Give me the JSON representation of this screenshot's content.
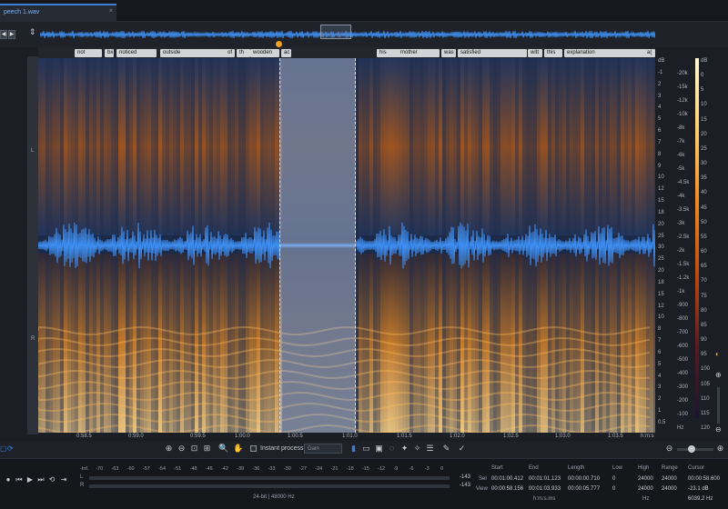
{
  "file": {
    "tab_label": "peech 1.wav",
    "close": "×"
  },
  "nav": {
    "prev": "◀",
    "next": "▶",
    "collapse": "⇕"
  },
  "channels": {
    "left": "L",
    "right": "R"
  },
  "words": [
    {
      "text": "not"
    },
    {
      "text": "bx"
    },
    {
      "text": "noticed"
    },
    {
      "text": "outside"
    },
    {
      "text": "of"
    },
    {
      "text": "th"
    },
    {
      "text": "wooden"
    },
    {
      "text": "ac"
    },
    {
      "text": "his"
    },
    {
      "text": "mother"
    },
    {
      "text": "was"
    },
    {
      "text": "satisfied"
    },
    {
      "text": "witt"
    },
    {
      "text": "this"
    },
    {
      "text": "explanation"
    },
    {
      "text": "a("
    }
  ],
  "db_scale": [
    "dB",
    "-1",
    "2",
    "3",
    "4",
    "5",
    "6",
    "7",
    "8",
    "9",
    "10",
    "12",
    "15",
    "18",
    "20",
    "25",
    "30",
    "25",
    "20",
    "18",
    "15",
    "12",
    "10",
    "8",
    "7",
    "6",
    "5",
    "4",
    "3",
    "2",
    "1",
    "0.5"
  ],
  "hz_scale": [
    "-20k",
    "-15k",
    "-12k",
    "-10k",
    "-8k",
    "-7k",
    "-6k",
    "-5k",
    "-4.5k",
    "-4k",
    "-3.5k",
    "-3k",
    "-2.5k",
    "-2k",
    "-1.5k",
    "-1.2k",
    "-1k",
    "-900",
    "-800",
    "-700",
    "-600",
    "-500",
    "-400",
    "-300",
    "-200",
    "-100",
    "Hz"
  ],
  "color_scale": [
    "dB",
    "0",
    "5",
    "10",
    "15",
    "20",
    "25",
    "30",
    "35",
    "40",
    "45",
    "50",
    "55",
    "60",
    "65",
    "70",
    "75",
    "80",
    "85",
    "90",
    "95",
    "100",
    "105",
    "110",
    "115",
    "120"
  ],
  "timeline": [
    "0:58.5",
    "0:59.0",
    "0:59.5",
    "1:00.0",
    "1:00.5",
    "1:01.0",
    "1:01.5",
    "1:02.0",
    "1:02.5",
    "1:03.0",
    "1:03.5",
    "h:m:s"
  ],
  "toolbar": {
    "instant_process": "Instant process",
    "gain": "Gain"
  },
  "meter_scale": [
    "-Inf.",
    "-70",
    "-63",
    "-60",
    "-57",
    "-54",
    "-51",
    "-48",
    "-45",
    "-42",
    "-39",
    "-36",
    "-33",
    "-30",
    "-27",
    "-24",
    "-21",
    "-18",
    "-15",
    "-12",
    "-9",
    "-6",
    "-3",
    "0"
  ],
  "meter_peaks": {
    "left": "-143",
    "right": "-143"
  },
  "format": "24-bit | 48000 Hz",
  "info": {
    "start_h": "Start",
    "end_h": "End",
    "length_h": "Length",
    "low_h": "Low",
    "high_h": "High",
    "range_h": "Range",
    "cursor_h": "Cursor",
    "sel_label": "Sel",
    "view_label": "View",
    "sel_start": "00:01:00.412",
    "sel_end": "00:01:01.123",
    "sel_length": "00:00:00.710",
    "view_start": "00:00:58.156",
    "view_end": "00:01:03.933",
    "view_length": "00:00:05.777",
    "sel_low": "0",
    "sel_high": "24000",
    "sel_range": "24000",
    "view_low": "0",
    "view_high": "24000",
    "view_range": "24000",
    "time_unit": "h:m:s.ms",
    "hz_unit": "Hz",
    "cursor_time": "00:00:58.600",
    "cursor_db": "-23.1 dB",
    "cursor_hz": "6039.2 Hz"
  },
  "colors": {
    "accent": "#3d7fd6",
    "waveform": "#3f8ef0",
    "spectrum_hot": "#f59a2a",
    "spectrum_cold": "#1c2a4a"
  }
}
